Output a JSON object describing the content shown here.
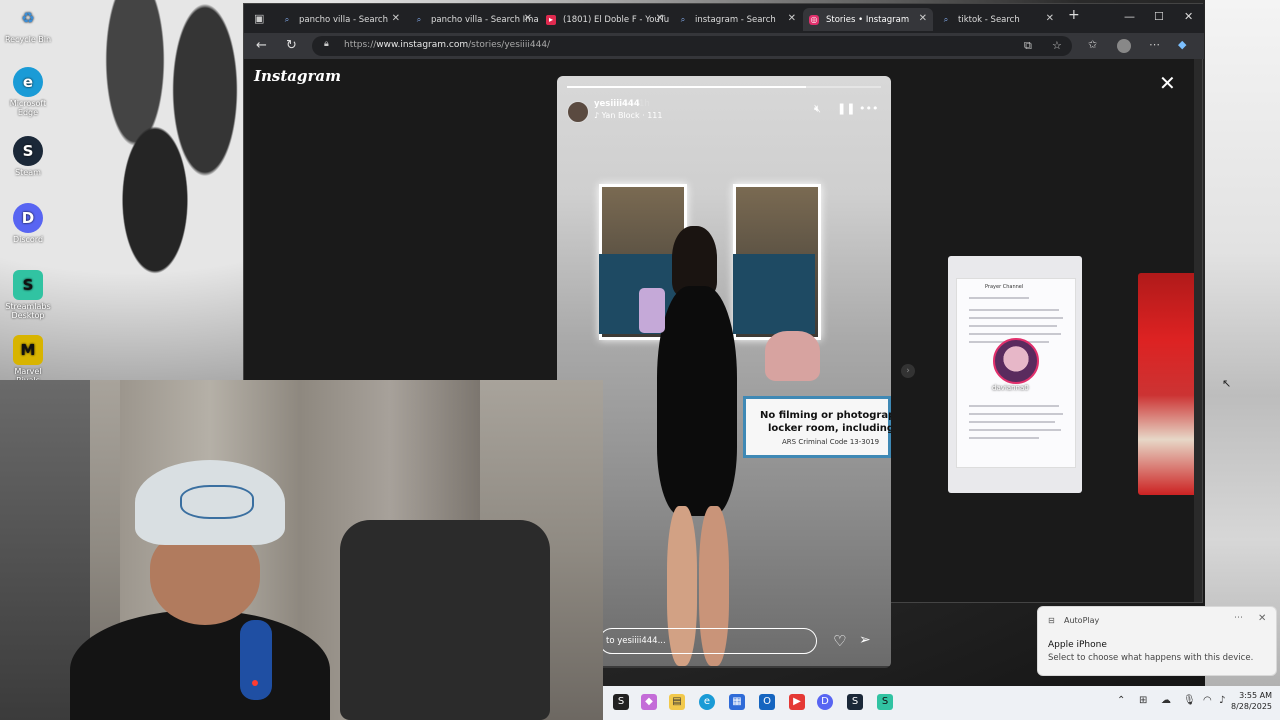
{
  "desktop": {
    "icons": [
      {
        "label": "Recycle Bin",
        "glyph": "♻",
        "color": "#3a8ed8"
      },
      {
        "label": "Microsoft Edge",
        "glyph": "e",
        "color": "#1a9bd6"
      },
      {
        "label": "Steam",
        "glyph": "S",
        "color": "#1b2838"
      },
      {
        "label": "Discord",
        "glyph": "D",
        "color": "#5865f2"
      },
      {
        "label": "Streamlabs Desktop",
        "glyph": "S",
        "color": "#31c3a2"
      },
      {
        "label": "Marvel Rivals",
        "glyph": "M",
        "color": "#d8b400"
      }
    ]
  },
  "browser": {
    "tabs": [
      {
        "label": "pancho villa - Search",
        "icon": "search-icon"
      },
      {
        "label": "pancho villa - Search Ima",
        "icon": "search-icon"
      },
      {
        "label": "(1801) El Doble F - YouTu",
        "icon": "youtube-icon"
      },
      {
        "label": "instagram - Search",
        "icon": "search-icon"
      },
      {
        "label": "Stories • Instagram",
        "icon": "instagram-icon"
      },
      {
        "label": "tiktok - Search",
        "icon": "search-icon"
      }
    ],
    "url_prefix": "https://",
    "url_host": "www.instagram.com",
    "url_path": "/stories/yesiiii444/"
  },
  "instagram": {
    "logo": "Instagram",
    "story": {
      "username": "yesiiii444",
      "time_ago": "1h",
      "music": "♪ Yan Block · 111",
      "progress": 0.76,
      "sign_line1": "No filming or photography",
      "sign_line2": "locker room, including s",
      "sign_line3": "ARS Criminal Code 13-3019",
      "reply_placeholder": "to yesiiii444..."
    },
    "preview1": {
      "title": "Prayer Channel",
      "name": "davianna0"
    }
  },
  "toast": {
    "app": "AutoPlay",
    "title": "Apple iPhone",
    "body": "Select to choose what happens with this device."
  },
  "clock": {
    "time": "3:55 AM",
    "date": "8/28/2025"
  }
}
